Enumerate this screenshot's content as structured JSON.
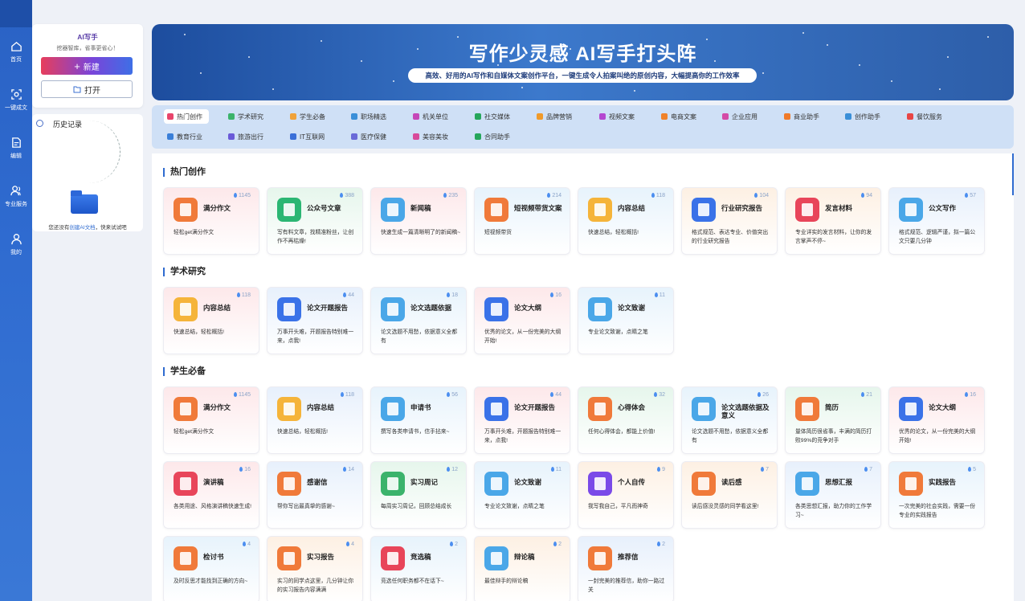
{
  "nav": [
    {
      "label": "首页",
      "icon": "home-icon"
    },
    {
      "label": "一键成文",
      "icon": "scan-icon"
    },
    {
      "label": "编辑",
      "icon": "edit-icon"
    },
    {
      "label": "专业服务",
      "icon": "users-icon"
    },
    {
      "label": "我的",
      "icon": "user-icon"
    }
  ],
  "left_panel": {
    "app_name": "AI写手",
    "tagline": "挖器智库，省事更省心！",
    "new_label": "新建",
    "new_icon": "+",
    "open_label": "打开",
    "history_title": "历史记录",
    "empty_prefix": "您还没有",
    "empty_link": "创建AI文档",
    "empty_suffix": "，快来试试吧"
  },
  "banner": {
    "title": "写作少灵感 AI写手打头阵",
    "subtitle": "高效、好用的AI写作和自媒体文案创作平台，一键生成令人拍案叫绝的原创内容，大幅提高你的工作效率"
  },
  "categories": [
    {
      "label": "热门创作",
      "color": "#e8456b",
      "active": true
    },
    {
      "label": "学术研究",
      "color": "#3bb36b"
    },
    {
      "label": "学生必备",
      "color": "#f0a23a"
    },
    {
      "label": "职场精选",
      "color": "#3a8fd8"
    },
    {
      "label": "机关单位",
      "color": "#c547b8"
    },
    {
      "label": "社交媒体",
      "color": "#26a65b"
    },
    {
      "label": "品牌营销",
      "color": "#f09a2a"
    },
    {
      "label": "视频文案",
      "color": "#b447d0"
    },
    {
      "label": "电商文案",
      "color": "#f0822a"
    },
    {
      "label": "企业应用",
      "color": "#d44aa6"
    },
    {
      "label": "商业助手",
      "color": "#f07a2a"
    },
    {
      "label": "创作助手",
      "color": "#3a8fd8"
    },
    {
      "label": "餐饮服务",
      "color": "#e84545"
    },
    {
      "label": "教育行业",
      "color": "#3a7fd8"
    },
    {
      "label": "旅游出行",
      "color": "#6a5ad8"
    },
    {
      "label": "IT互联网",
      "color": "#3a6fd8"
    },
    {
      "label": "医疗保健",
      "color": "#6a6ad8"
    },
    {
      "label": "美容美妆",
      "color": "#d84a9a"
    },
    {
      "label": "合同助手",
      "color": "#26a65b"
    }
  ],
  "sections": [
    {
      "title": "热门创作",
      "cards": [
        {
          "title": "满分作文",
          "count": "1145",
          "desc": "轻松get满分作文",
          "color": "#f07a3a",
          "bg": "#fde8ea"
        },
        {
          "title": "公众号文章",
          "count": "388",
          "desc": "写有料文章，找精准粉丝，让创作不再枯燥!",
          "color": "#2bb673",
          "bg": "#e6f6ec"
        },
        {
          "title": "新闻稿",
          "count": "235",
          "desc": "快速生成一篇清晰明了的新闻稿~",
          "color": "#4aa7e8",
          "bg": "#fde8ea"
        },
        {
          "title": "短视频带货文案",
          "count": "214",
          "desc": "短视频带货",
          "color": "#f07a3a",
          "bg": "#e7f3fc"
        },
        {
          "title": "内容总结",
          "count": "118",
          "desc": "快速总结，轻松概括!",
          "color": "#f5b43a",
          "bg": "#e7f3fc"
        },
        {
          "title": "行业研究报告",
          "count": "104",
          "desc": "格式规范、表达专业、价值突出的行业研究报告",
          "color": "#3a72e8",
          "bg": "#fdf0e3"
        },
        {
          "title": "发言材料",
          "count": "94",
          "desc": "专业详实的发言材料，让你的发言掌声不停~",
          "color": "#e8455a",
          "bg": "#fdf0e3"
        },
        {
          "title": "公文写作",
          "count": "57",
          "desc": "格式规范、逻辑严谨，拟一篇公文只要几分钟",
          "color": "#4aa7e8",
          "bg": "#e7f0fc"
        }
      ]
    },
    {
      "title": "学术研究",
      "cards": [
        {
          "title": "内容总结",
          "count": "118",
          "desc": "快速总结，轻松概括!",
          "color": "#f5b43a",
          "bg": "#fde8ea"
        },
        {
          "title": "论文开题报告",
          "count": "44",
          "desc": "万事开头难，开题报告特别难一来，点我!",
          "color": "#3a72e8",
          "bg": "#e7f0fc"
        },
        {
          "title": "论文选题依据",
          "count": "18",
          "desc": "论文选题不用愁，依据意义全都有",
          "color": "#4aa7e8",
          "bg": "#e7f3fc"
        },
        {
          "title": "论文大纲",
          "count": "16",
          "desc": "优秀的论文，从一份完美的大纲开始!",
          "color": "#3a72e8",
          "bg": "#fde8ea"
        },
        {
          "title": "论文致谢",
          "count": "11",
          "desc": "专业论文致谢，点睛之笔",
          "color": "#4aa7e8",
          "bg": "#e7f3fc"
        }
      ]
    },
    {
      "title": "学生必备",
      "cards": [
        {
          "title": "满分作文",
          "count": "1145",
          "desc": "轻松get满分作文",
          "color": "#f07a3a",
          "bg": "#fde8ea"
        },
        {
          "title": "内容总结",
          "count": "118",
          "desc": "快速总结，轻松概括!",
          "color": "#f5b43a",
          "bg": "#e7f0fc"
        },
        {
          "title": "申请书",
          "count": "56",
          "desc": "撰写各类申请书，信手拈来~",
          "color": "#4aa7e8",
          "bg": "#e7f3fc"
        },
        {
          "title": "论文开题报告",
          "count": "44",
          "desc": "万事开头难，开题报告特别难一来，点我!",
          "color": "#3a72e8",
          "bg": "#fde8ea"
        },
        {
          "title": "心得体会",
          "count": "32",
          "desc": "任何心得体会，都能上价值!",
          "color": "#f07a3a",
          "bg": "#e6f6ec"
        },
        {
          "title": "论文选题依据及意义",
          "count": "26",
          "desc": "论文选题不用愁，依据意义全都有",
          "color": "#4aa7e8",
          "bg": "#e7f3fc"
        },
        {
          "title": "简历",
          "count": "21",
          "desc": "量体简历很省事，丰满的简历打败99%的竞争对手",
          "color": "#f07a3a",
          "bg": "#e6f6ec"
        },
        {
          "title": "论文大纲",
          "count": "16",
          "desc": "优秀的论文，从一份完美的大纲开始!",
          "color": "#3a72e8",
          "bg": "#fde8ea"
        },
        {
          "title": "演讲稿",
          "count": "16",
          "desc": "各类用途、风格演讲稿快速生成!",
          "color": "#e8455a",
          "bg": "#fde8ea"
        },
        {
          "title": "感谢信",
          "count": "14",
          "desc": "帮你写出最真挚的感谢~",
          "color": "#f07a3a",
          "bg": "#e7f0fc"
        },
        {
          "title": "实习周记",
          "count": "12",
          "desc": "每周实习周记，回顾总结成长",
          "color": "#3bb36b",
          "bg": "#e6f6ec"
        },
        {
          "title": "论文致谢",
          "count": "11",
          "desc": "专业论文致谢，点睛之笔",
          "color": "#4aa7e8",
          "bg": "#e7f3fc"
        },
        {
          "title": "个人自传",
          "count": "9",
          "desc": "我写我自己，平凡而神奇",
          "color": "#7a4ae8",
          "bg": "#fdf0e3"
        },
        {
          "title": "读后感",
          "count": "7",
          "desc": "读后感没灵感的同学看这里!",
          "color": "#f07a3a",
          "bg": "#fdf0e3"
        },
        {
          "title": "思想汇报",
          "count": "7",
          "desc": "各类思想汇报，助力你的工作学习~",
          "color": "#4aa7e8",
          "bg": "#e7f0fc"
        },
        {
          "title": "实践报告",
          "count": "5",
          "desc": "一次完美的社会实践，需要一份专业的实践报告",
          "color": "#f07a3a",
          "bg": "#e7f3fc"
        },
        {
          "title": "检讨书",
          "count": "4",
          "desc": "及时反思才能找到正确的方向~",
          "color": "#f07a3a",
          "bg": "#e7f3fc"
        },
        {
          "title": "实习报告",
          "count": "4",
          "desc": "实习的同学点这里，几分钟让你的实习报告内容满满",
          "color": "#f07a3a",
          "bg": "#fdf0e3"
        },
        {
          "title": "竞选稿",
          "count": "2",
          "desc": "竞选任何职务都不在话下~",
          "color": "#e8455a",
          "bg": "#e7f3fc"
        },
        {
          "title": "辩论稿",
          "count": "2",
          "desc": "最佳辩手的辩论稿",
          "color": "#4aa7e8",
          "bg": "#fdf0e3"
        },
        {
          "title": "推荐信",
          "count": "2",
          "desc": "一封完美的推荐信，助你一路过关",
          "color": "#f07a3a",
          "bg": "#e7f0fc"
        }
      ]
    }
  ]
}
